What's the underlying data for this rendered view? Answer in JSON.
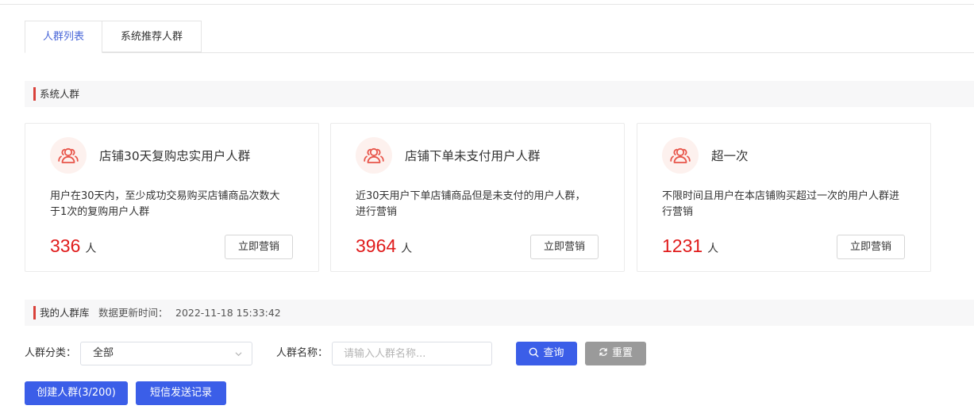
{
  "tabs": [
    {
      "label": "人群列表",
      "active": true
    },
    {
      "label": "系统推荐人群",
      "active": false
    }
  ],
  "system_section": {
    "title": "系统人群"
  },
  "cards": [
    {
      "name": "店铺30天复购忠实用户人群",
      "desc": "用户在30天内，至少成功交易购买店铺商品次数大于1次的复购用户人群",
      "count": "336",
      "unit": "人",
      "button": "立即营销",
      "icon": "users-icon"
    },
    {
      "name": "店铺下单未支付用户人群",
      "desc": "近30天用户下单店铺商品但是未支付的用户人群，进行营销",
      "count": "3964",
      "unit": "人",
      "button": "立即营销",
      "icon": "users-icon"
    },
    {
      "name": "超一次",
      "desc": "不限时间且用户在本店铺购买超过一次的用户人群进行营销",
      "count": "1231",
      "unit": "人",
      "button": "立即营销",
      "icon": "users-icon"
    }
  ],
  "library_section": {
    "title": "我的人群库",
    "update_label": "数据更新时间：",
    "update_time": "2022-11-18 15:33:42"
  },
  "filters": {
    "category_label": "人群分类：",
    "category_value": "全部",
    "name_label": "人群名称：",
    "name_placeholder": "请输入人群名称...",
    "query_button": "查询",
    "reset_button": "重置"
  },
  "actions": {
    "create_button": "创建人群(3/200)",
    "sms_button": "短信发送记录"
  },
  "colors": {
    "accent": "#3b5ee8",
    "count_red": "#e01b1b",
    "section_mark": "#d9413a",
    "reset_gray": "#9a9a9a"
  }
}
